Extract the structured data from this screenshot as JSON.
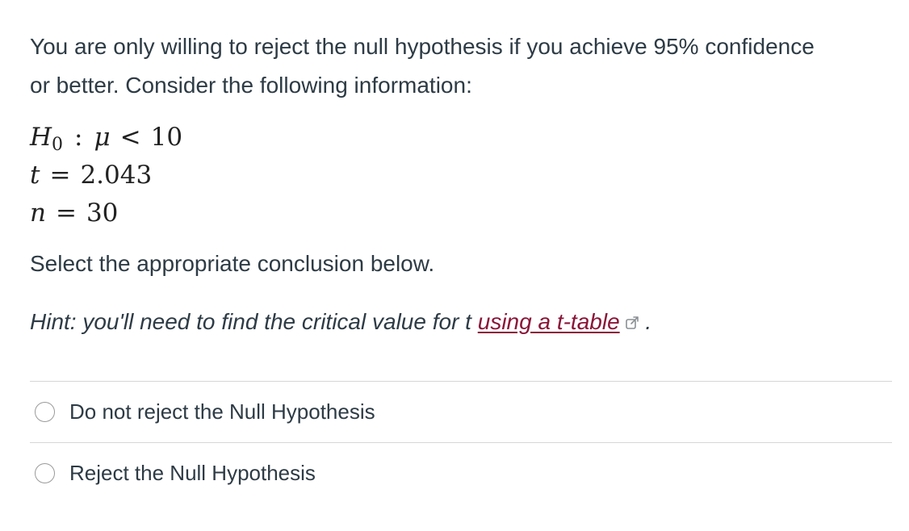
{
  "question": {
    "prompt": "You are only willing to reject the null hypothesis if you achieve 95% confidence or better. Consider the following information:",
    "hypothesis": {
      "symbol": "H",
      "subscript": "0",
      "colon": ":",
      "param": "μ",
      "relation": "<",
      "value": "10"
    },
    "t_stat": {
      "symbol": "t",
      "relation": "=",
      "value": "2.043"
    },
    "sample_size": {
      "symbol": "n",
      "relation": "=",
      "value": "30"
    },
    "instruction": "Select the appropriate conclusion below.",
    "hint": {
      "prefix": "Hint: you'll need to find the critical value for t ",
      "link_text": "using a t-table",
      "suffix": " .",
      "link_icon": "external-link-icon"
    }
  },
  "options": [
    {
      "label": "Do not reject the Null Hypothesis",
      "selected": false
    },
    {
      "label": "Reject the Null Hypothesis",
      "selected": false
    }
  ],
  "colors": {
    "text": "#2d3b45",
    "link": "#8a1538",
    "divider": "#d6d6d6"
  }
}
